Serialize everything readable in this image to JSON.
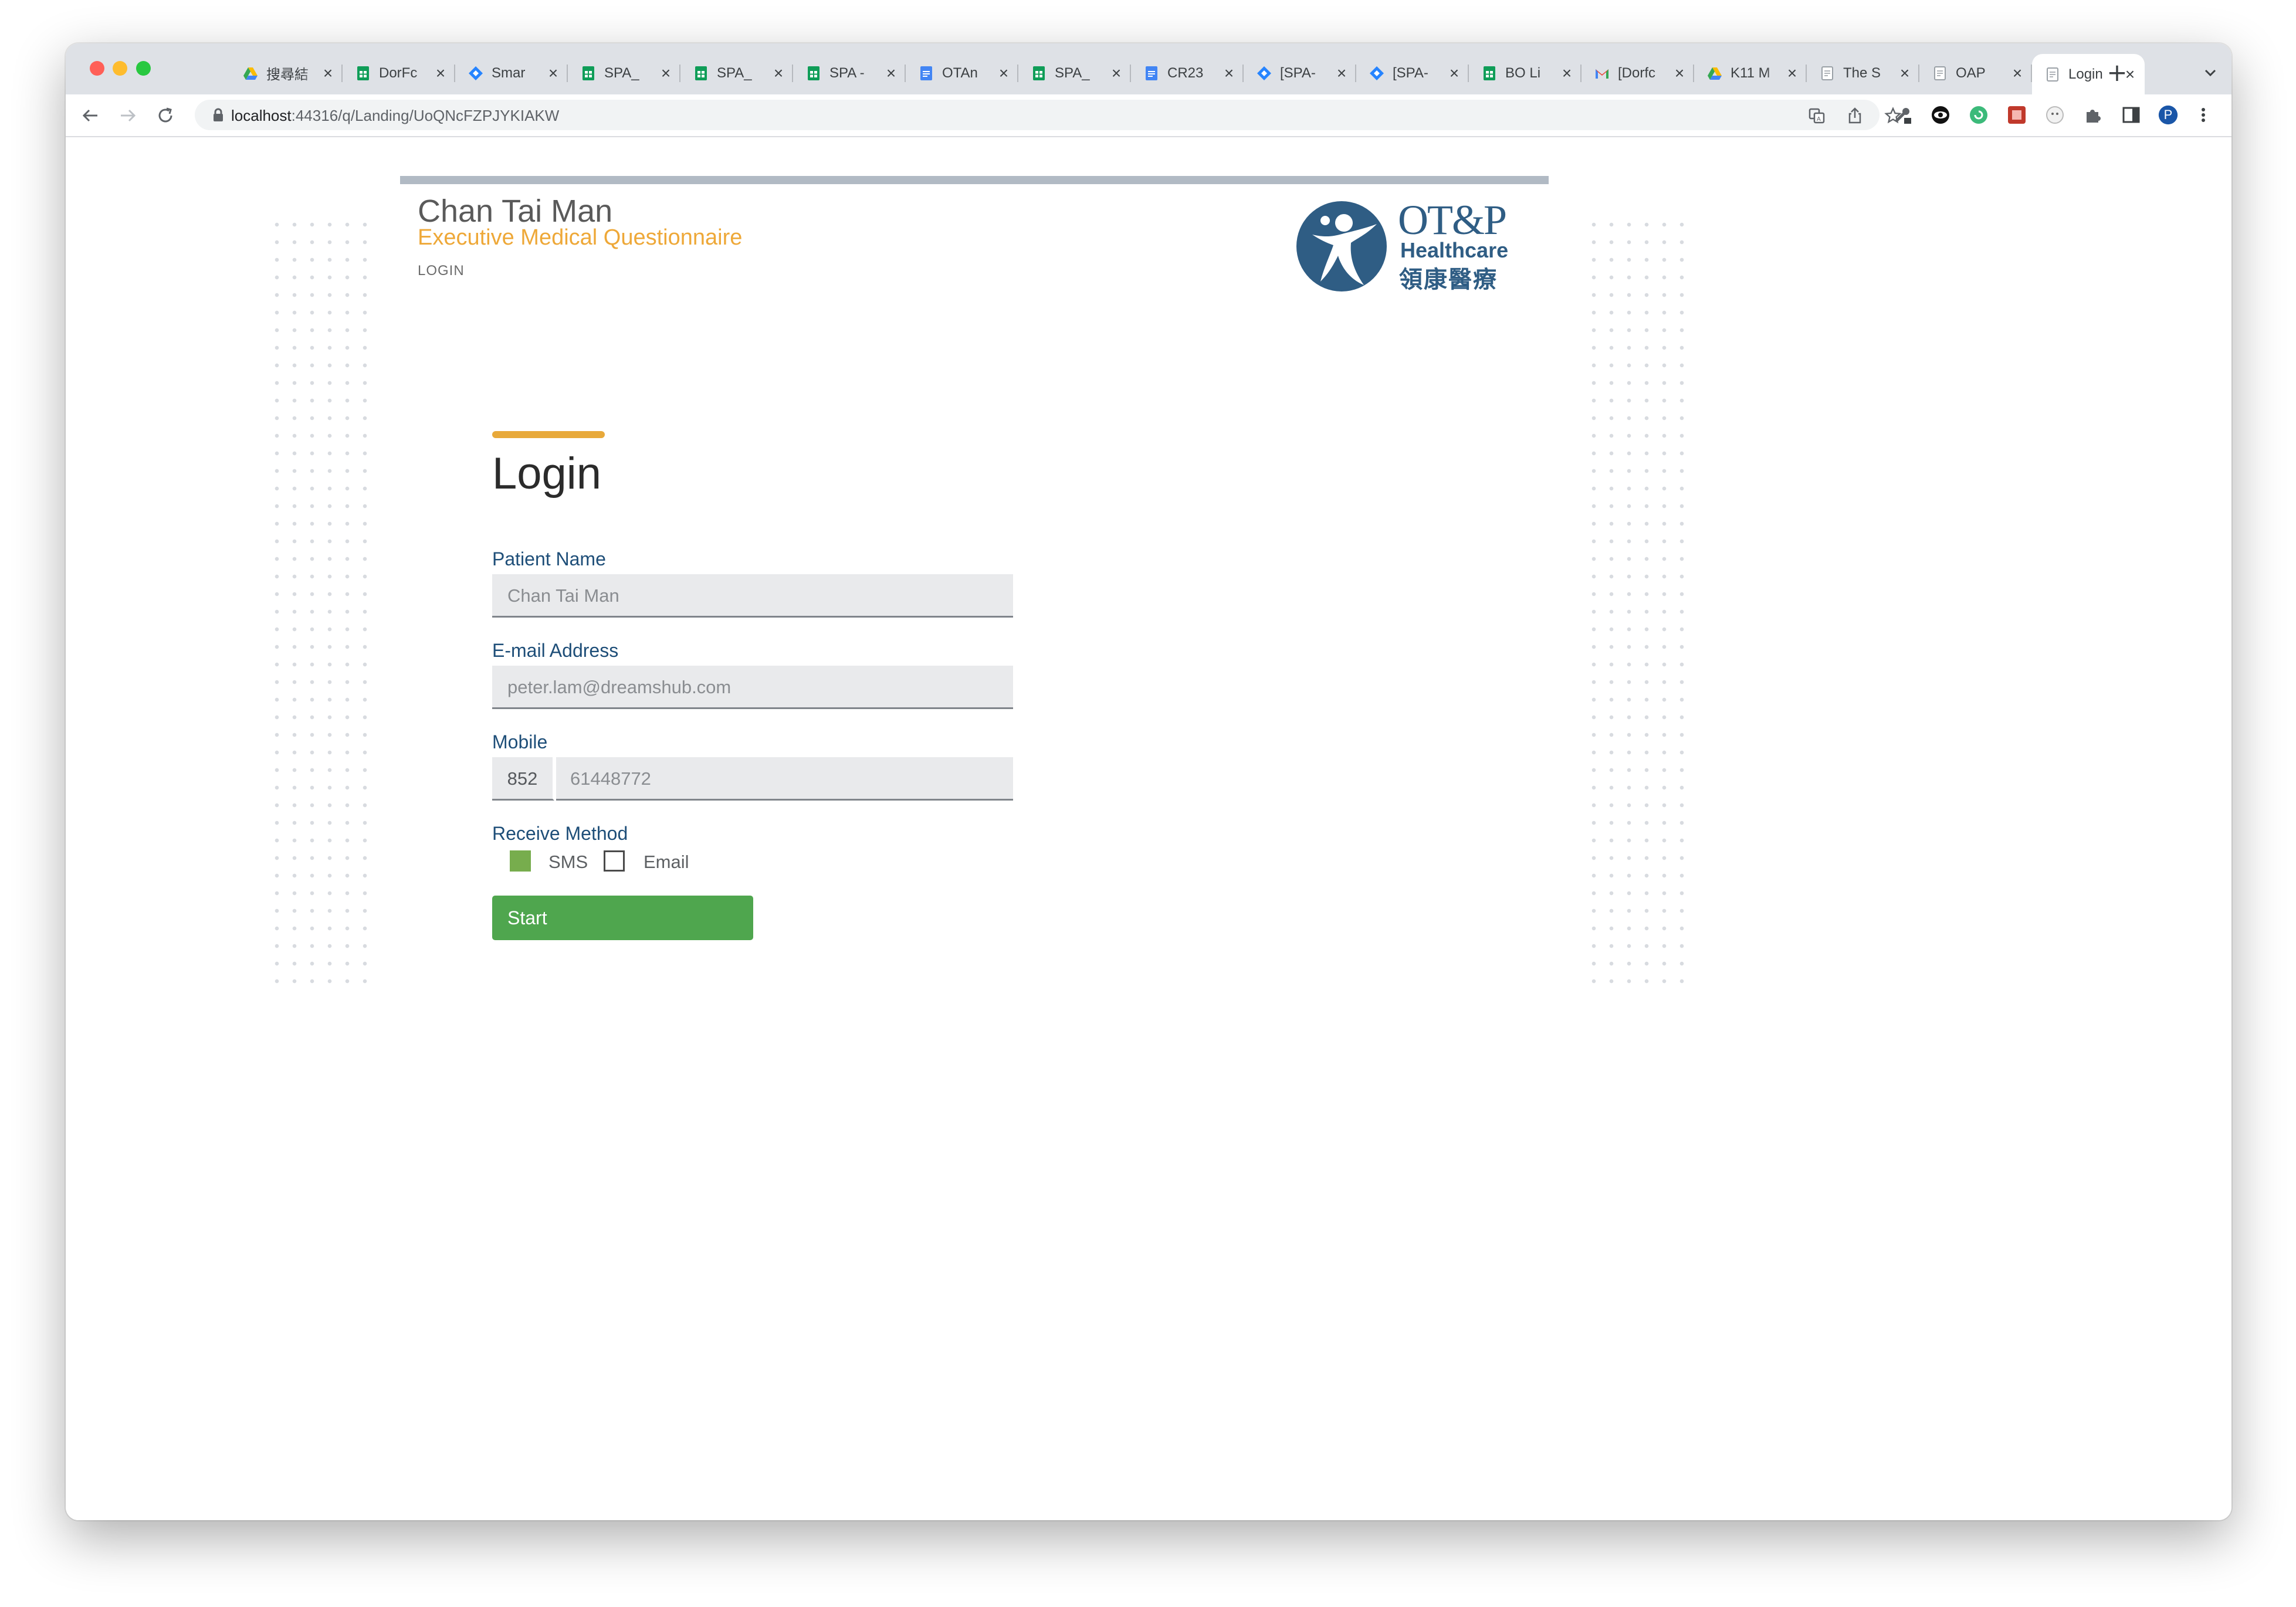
{
  "browser": {
    "tabs": [
      {
        "title": "搜尋結",
        "icon": "google-drive-icon"
      },
      {
        "title": "DorFc",
        "icon": "google-sheets-icon"
      },
      {
        "title": "Smar",
        "icon": "jira-icon"
      },
      {
        "title": "SPA_",
        "icon": "google-sheets-icon"
      },
      {
        "title": "SPA_",
        "icon": "google-sheets-icon"
      },
      {
        "title": "SPA -",
        "icon": "google-sheets-icon"
      },
      {
        "title": "OTAn",
        "icon": "google-docs-icon"
      },
      {
        "title": "SPA_",
        "icon": "google-sheets-icon"
      },
      {
        "title": "CR23",
        "icon": "google-docs-icon"
      },
      {
        "title": "[SPA-",
        "icon": "jira-icon"
      },
      {
        "title": "[SPA-",
        "icon": "jira-icon"
      },
      {
        "title": "BO Li",
        "icon": "google-sheets-icon"
      },
      {
        "title": "[Dorfc",
        "icon": "gmail-icon"
      },
      {
        "title": "K11 M",
        "icon": "google-drive-icon"
      },
      {
        "title": "The S",
        "icon": "page-icon"
      },
      {
        "title": "OAP",
        "icon": "page-icon"
      },
      {
        "title": "Login",
        "icon": "page-icon",
        "active": true
      }
    ],
    "url_host": "localhost",
    "url_path": ":44316/q/Landing/UoQNcFZPJYKIAKW",
    "profile_initial": "P"
  },
  "header": {
    "patient_name": "Chan Tai Man",
    "subtitle": "Executive Medical Questionnaire",
    "breadcrumb": "LOGIN",
    "logo_line1": "OT&P",
    "logo_line2": "Healthcare",
    "logo_line3": "領康醫療"
  },
  "form": {
    "heading": "Login",
    "patient_name_label": "Patient Name",
    "patient_name_value": "Chan Tai Man",
    "email_label": "E-mail Address",
    "email_value": "peter.lam@dreamshub.com",
    "mobile_label": "Mobile",
    "mobile_prefix": "852",
    "mobile_value": "61448772",
    "receive_label": "Receive Method",
    "sms_label": "SMS",
    "sms_checked": true,
    "email_option_label": "Email",
    "email_checked": false,
    "start_label": "Start"
  },
  "colors": {
    "accent": "#e8a93a",
    "label_blue": "#1e4e78",
    "button_green": "#4fa64e",
    "checkbox_green": "#77ad4d"
  }
}
